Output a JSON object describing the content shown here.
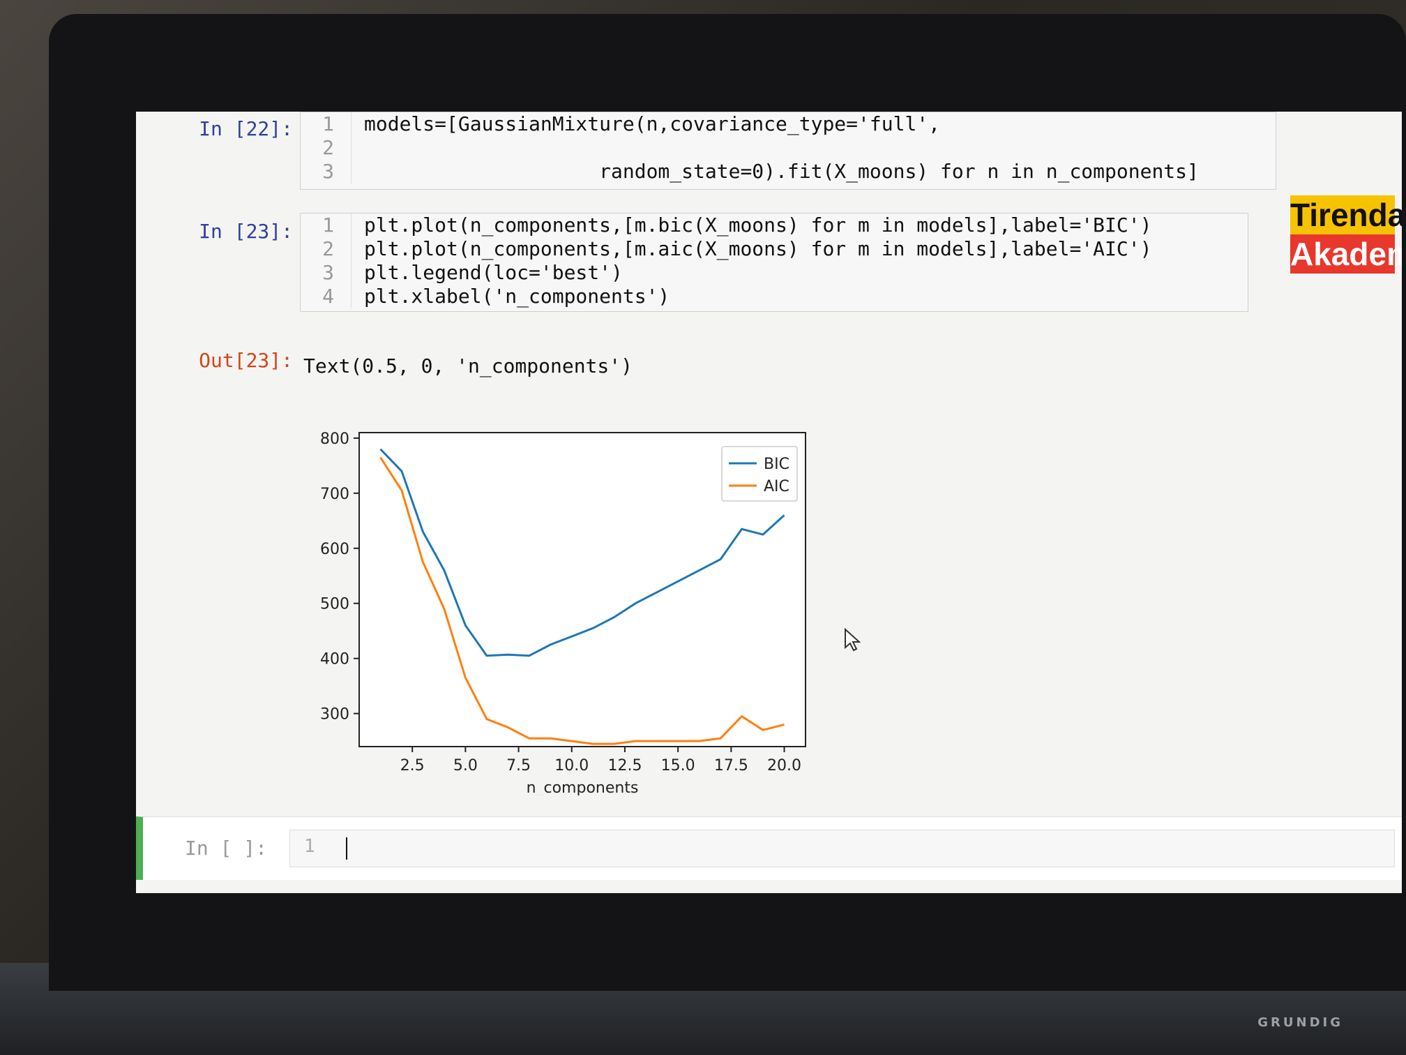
{
  "logo": {
    "line1": "Tirendaz",
    "line2": "Akademi"
  },
  "cells": [
    {
      "prompt": "In [22]:",
      "lines": [
        {
          "n": "1",
          "code": "models=[GaussianMixture(n,covariance_type='full',"
        },
        {
          "n": "2",
          "code": ""
        },
        {
          "n": "3",
          "code": "                    random_state=0).fit(X_moons) for n in n_components]"
        }
      ]
    },
    {
      "prompt": "In [23]:",
      "lines": [
        {
          "n": "1",
          "code": "plt.plot(n_components,[m.bic(X_moons) for m in models],label='BIC')"
        },
        {
          "n": "2",
          "code": "plt.plot(n_components,[m.aic(X_moons) for m in models],label='AIC')"
        },
        {
          "n": "3",
          "code": "plt.legend(loc='best')"
        },
        {
          "n": "4",
          "code": "plt.xlabel('n_components')"
        }
      ]
    }
  ],
  "output": {
    "prompt": "Out[23]:",
    "text": "Text(0.5, 0, 'n_components')"
  },
  "next_cell": {
    "prompt": "In [ ]:",
    "line": "1"
  },
  "chart_data": {
    "type": "line",
    "xlabel": "n_components",
    "ylabel": "",
    "xlim": [
      0.0,
      21.0
    ],
    "ylim": [
      240,
      810
    ],
    "xticks": [
      "2.5",
      "5.0",
      "7.5",
      "10.0",
      "12.5",
      "15.0",
      "17.5",
      "20.0"
    ],
    "yticks": [
      "300",
      "400",
      "500",
      "600",
      "700",
      "800"
    ],
    "legend": "top-right",
    "x": [
      1,
      2,
      3,
      4,
      5,
      6,
      7,
      8,
      9,
      10,
      11,
      12,
      13,
      14,
      15,
      16,
      17,
      18,
      19,
      20
    ],
    "series": [
      {
        "name": "BIC",
        "color": "#1f77b4",
        "values": [
          780,
          740,
          630,
          560,
          460,
          405,
          407,
          405,
          425,
          440,
          455,
          475,
          500,
          520,
          540,
          560,
          580,
          635,
          625,
          660
        ]
      },
      {
        "name": "AIC",
        "color": "#ff7f0e",
        "values": [
          765,
          705,
          575,
          490,
          365,
          290,
          275,
          255,
          255,
          250,
          245,
          245,
          250,
          250,
          250,
          250,
          255,
          295,
          270,
          280
        ]
      }
    ]
  }
}
